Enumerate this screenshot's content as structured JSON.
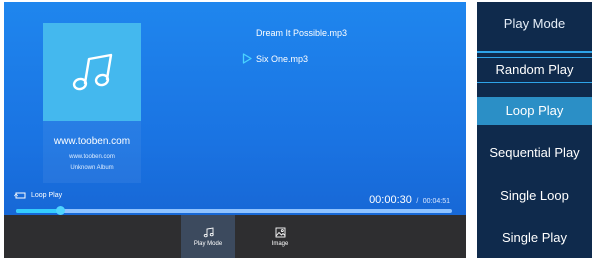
{
  "player": {
    "album_site": "www.tooben.com",
    "album_site_small": "www.tooben.com",
    "album_name": "Unknown Album",
    "playlist": [
      "Dream It Possible.mp3",
      "Six One.mp3"
    ],
    "now_playing_index": 1,
    "loop_label": "Loop Play",
    "time_current": "00:00:30",
    "time_separator": "/",
    "time_total": "00:04:51",
    "progress": 0.1,
    "buttons": [
      {
        "label": "Play Mode",
        "icon": "music-note-icon",
        "active": true
      },
      {
        "label": "Image",
        "icon": "image-icon",
        "active": false
      }
    ]
  },
  "menu": {
    "title": "Play Mode",
    "items": [
      "Random Play",
      "Loop Play",
      "Sequential Play",
      "Single Loop",
      "Single Play"
    ],
    "selected_index": 1
  },
  "colors": {
    "background_top": "#1f86ee",
    "cover": "#44b8ee",
    "accent": "#35cdfd",
    "menu_bg": "#0f2a4c",
    "menu_selected": "#2b8fc6"
  }
}
